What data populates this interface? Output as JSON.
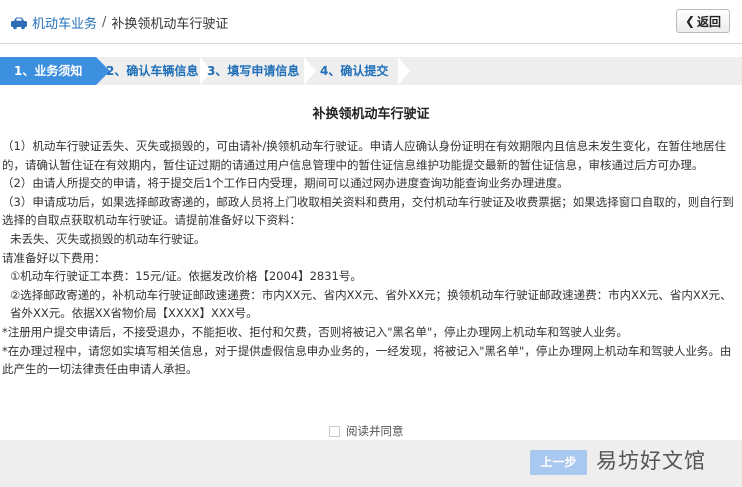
{
  "header": {
    "breadcrumb_root": "机动车业务",
    "breadcrumb_sep": "/",
    "breadcrumb_current": "补换领机动车行驶证",
    "back_label": "返回"
  },
  "steps": [
    {
      "label": "1、业务须知",
      "active": true
    },
    {
      "label": "2、确认车辆信息",
      "active": false
    },
    {
      "label": "3、填写申请信息",
      "active": false
    },
    {
      "label": "4、确认提交",
      "active": false
    }
  ],
  "document": {
    "title": "补换领机动车行驶证",
    "paragraphs": [
      "（1）机动车行驶证丢失、灭失或损毁的，可由请补/换领机动车行驶证。申请人应确认身份证明在有效期限内且信息未发生变化，在暂住地居住的，请确认暂住证在有效期内，暂住证过期的请通过用户信息管理中的暂住证信息维护功能提交最新的暂住证信息，审核通过后方可办理。",
      "（2）由请人所提交的申请，将于提交后1个工作日内受理，期间可以通过网办进度查询功能查询业务办理进度。",
      "（3）申请成功后，如果选择邮政寄递的，邮政人员将上门收取相关资料和费用，交付机动车行驶证及收费票据；如果选择窗口自取的，则自行到选择的自取点获取机动车行驶证。请提前准备好以下资料：",
      "未丢失、灭失或损毁的机动车行驶证。",
      "请准备好以下费用：",
      "①机动车行驶证工本费：15元/证。依据发改价格【2004】2831号。",
      "②选择邮政寄递的，补机动车行驶证邮政速递费：市内XX元、省内XX元、省外XX元；换领机动车行驶证邮政速递费：市内XX元、省内XX元、省外XX元。依据XX省物价局【XXXX】XXX号。",
      "*注册用户提交申请后，不接受退办，不能拒收、拒付和欠费，否则将被记入\"黑名单\"，停止办理网上机动车和驾驶人业务。",
      "*在办理过程中，请您如实填写相关信息，对于提供虚假信息申办业务的，一经发现，将被记入\"黑名单\"，停止办理网上机动车和驾驶人业务。由此产生的一切法律责任由申请人承担。"
    ]
  },
  "agree_label": "阅读并同意",
  "footer": {
    "prev_label": "上一步",
    "watermark": "易坊好文馆"
  },
  "icons": {
    "car": "car-icon",
    "back": "chevron-left-icon",
    "watermark_logo": "house-logo-icon"
  },
  "colors": {
    "accent": "#3d8fe0",
    "link": "#1f6fb8",
    "prev_button": "#a9c8ef",
    "step_bar": "#eeeeee"
  }
}
